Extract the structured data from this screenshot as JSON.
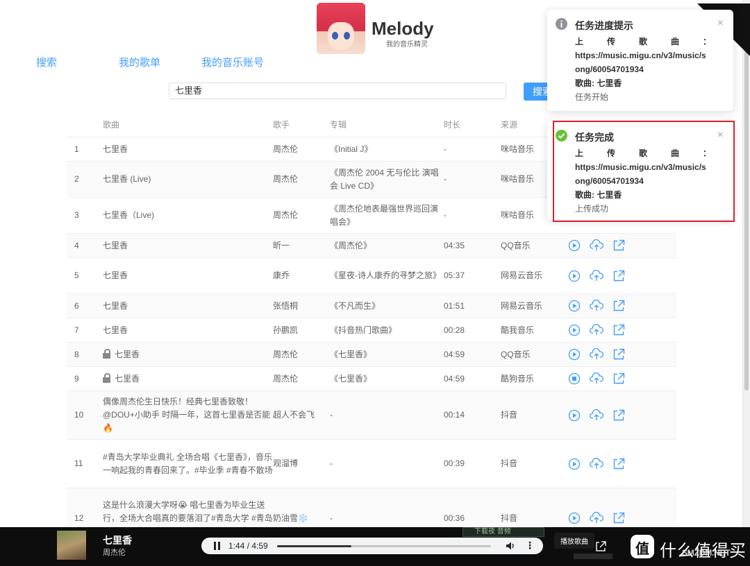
{
  "app": {
    "title": "Melody",
    "subtitle": "我的音乐精灵"
  },
  "nav": {
    "search": "搜索",
    "playlist": "我的歌单",
    "account": "我的音乐账号"
  },
  "search": {
    "value": "七里香",
    "button": "搜索"
  },
  "table": {
    "headers": {
      "song": "歌曲",
      "artist": "歌手",
      "album": "专辑",
      "duration": "时长",
      "source": "来源"
    },
    "rows": [
      {
        "idx": "1",
        "song": "七里香",
        "artist": "周杰伦",
        "album": "《Initial J》",
        "duration": "-",
        "source": "咪咕音乐"
      },
      {
        "idx": "2",
        "song": "七里香 (Live)",
        "artist": "周杰伦",
        "album": "《周杰伦 2004 无与伦比 演唱会 Live CD》",
        "duration": "-",
        "source": "咪咕音乐"
      },
      {
        "idx": "3",
        "song": "七里香（Live)",
        "artist": "周杰伦",
        "album": "《周杰伦地表最强世界巡回演唱会》",
        "duration": "-",
        "source": "咪咕音乐"
      },
      {
        "idx": "4",
        "song": "七里香",
        "artist": "昕一",
        "album": "《周杰伦》",
        "duration": "04:35",
        "source": "QQ音乐"
      },
      {
        "idx": "5",
        "song": "七里香",
        "artist": "康乔",
        "album": "《星夜-诗人康乔的寻梦之旅》",
        "duration": "05:37",
        "source": "网易云音乐"
      },
      {
        "idx": "6",
        "song": "七里香",
        "artist": "张悟桐",
        "album": "《不凡而生》",
        "duration": "01:51",
        "source": "网易云音乐"
      },
      {
        "idx": "7",
        "song": "七里香",
        "artist": "孙鹏凯",
        "album": "《抖音热门歌曲》",
        "duration": "00:28",
        "source": "酷我音乐"
      },
      {
        "idx": "8",
        "song": "七里香",
        "artist": "周杰伦",
        "album": "《七里香》",
        "duration": "04:59",
        "source": "QQ音乐"
      },
      {
        "idx": "9",
        "song": "七里香",
        "artist": "周杰伦",
        "album": "《七里香》",
        "duration": "04:59",
        "source": "酷狗音乐"
      },
      {
        "idx": "10",
        "song": "偶像周杰伦生日快乐！经典七里香致敬！@DOU+小助手 时隔一年，这首七里香是否能🔥",
        "artist": "超人不会飞",
        "album": "-",
        "duration": "00:14",
        "source": "抖音"
      },
      {
        "idx": "11",
        "song": "#青岛大学毕业典礼 全场合唱《七里香》，音乐一响起我的青春回来了。#毕业季 #青春不散场",
        "artist": "观溜博",
        "album": "-",
        "duration": "00:39",
        "source": "抖音"
      },
      {
        "idx": "12",
        "song": "这是什么浪漫大学呀😭 唱七里香为毕业生送行，全场大合唱真的要落泪了#青岛大学 #青岛大学毕业典礼 #我的青春 #前程似锦 #毕业",
        "artist": "奶油雪❄️",
        "album": "-",
        "duration": "00:36",
        "source": "抖音"
      }
    ]
  },
  "notifications": [
    {
      "title": "任务进度提示",
      "label": "上传歌曲：",
      "url": "https://music.migu.cn/v3/music/song/60054701934",
      "song": "歌曲: 七里香",
      "status": "任务开始",
      "icon": "info-icon",
      "color": "#909399"
    },
    {
      "title": "任务完成",
      "label": "上传歌曲：",
      "url": "https://music.migu.cn/v3/music/song/60054701934",
      "song": "歌曲: 七里香",
      "status": "上传成功",
      "icon": "success-icon",
      "color": "#67c23a"
    }
  ],
  "player": {
    "title": "七里香",
    "artist": "周杰伦",
    "time": "1:44 / 4:59",
    "progress": 0.348,
    "tooltip": "播放歌曲",
    "download_bar": "下载夜 音频"
  },
  "watermark": {
    "text": "什么值得买",
    "url": "SMZDM.NET"
  },
  "colors": {
    "accent": "#409eff",
    "highlight": "#d9232e",
    "success": "#67c23a"
  }
}
